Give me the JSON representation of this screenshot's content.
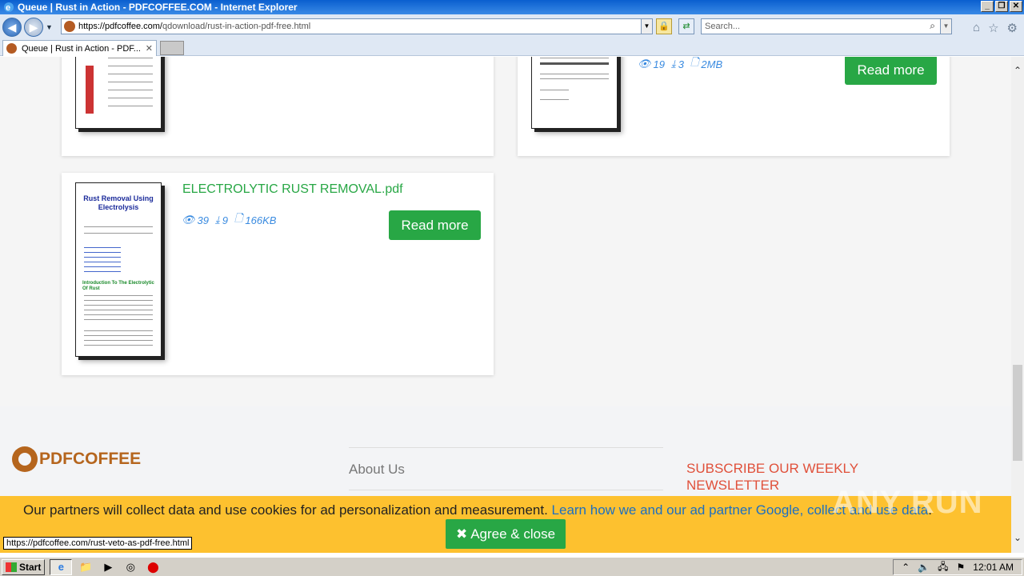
{
  "window": {
    "title": "Queue | Rust in Action - PDFCOFFEE.COM - Internet Explorer"
  },
  "address": {
    "host": "https://pdfcoffee.com/",
    "path": "qdownload/rust-in-action-pdf-free.html"
  },
  "search": {
    "placeholder": "Search..."
  },
  "tab": {
    "label": "Queue | Rust in Action - PDF..."
  },
  "cards": [
    {
      "meta_views": "19",
      "meta_downloads": "3",
      "meta_size": "2MB",
      "button": "Read more"
    },
    {
      "title": "ELECTROLYTIC RUST REMOVAL.pdf",
      "meta_views": "39",
      "meta_downloads": "9",
      "meta_size": "166KB",
      "button": "Read more",
      "thumb_title": "Rust Removal Using Electrolysis",
      "thumb_subtitle": "Introduction To The Electrolytic Of Rust"
    }
  ],
  "footer": {
    "logo": "PDFCOFFEE",
    "about": "About Us",
    "subscribe": "SUBSCRIBE OUR WEEKLY NEWSLETTER"
  },
  "cookie": {
    "text": "Our partners will collect data and use cookies for ad personalization and measurement.",
    "link": "Learn how we and our ad partner Google, collect and use data",
    "end": ".",
    "button": "Agree & close"
  },
  "watermark": "ANY RUN",
  "status": {
    "url": "https://pdfcoffee.com/rust-veto-as-pdf-free.html"
  },
  "taskbar": {
    "start": "Start",
    "clock": "12:01 AM"
  },
  "colors": {
    "accent_green": "#28a745",
    "link_blue": "#1c6fc2",
    "cookie_bg": "#fdc12f",
    "brand": "#b5651d"
  }
}
